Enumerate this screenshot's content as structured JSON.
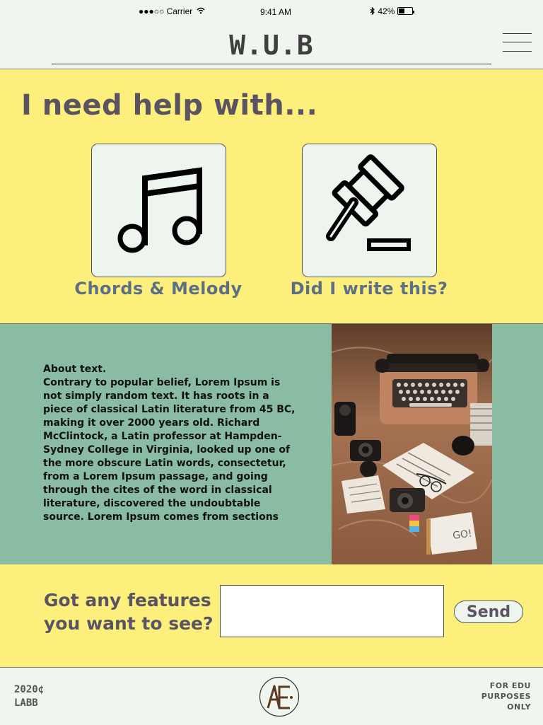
{
  "status_bar": {
    "carrier": "●●●○○ Carrier",
    "time": "9:41 AM",
    "battery": "42%"
  },
  "header": {
    "title": "W.U.B"
  },
  "help": {
    "heading": "I need help with...",
    "cards": [
      {
        "label": "Chords & Melody",
        "icon": "music-note-icon"
      },
      {
        "label": "Did I write this?",
        "icon": "gavel-icon"
      }
    ]
  },
  "about": {
    "title": "About text.",
    "body": "Contrary to popular belief, Lorem Ipsum is not simply random text. It has roots in a piece of classical Latin literature from 45 BC, making it over 2000 years old. Richard McClintock, a Latin professor at Hampden-Sydney College in Virginia, looked up one of the more obscure Latin words, consectetur, from a Lorem Ipsum passage, and going through the cites of the word in classical literature, discovered the undoubtable source. Lorem Ipsum comes from sections",
    "image": "typewriter-desk-photo",
    "photo_note": "GO!"
  },
  "feedback": {
    "line1": "Got any features",
    "line2": "you want to see?",
    "input_value": "",
    "send_label": "Send"
  },
  "footer": {
    "left_line1": "2020¢",
    "left_line2": "LABB",
    "logo": "AE",
    "right_line1": "FOR EDU",
    "right_line2": "PURPOSES",
    "right_line3": "ONLY"
  },
  "colors": {
    "yellow": "#fdef7c",
    "green": "#89bca3",
    "header_bg": "#f0f5ef",
    "heading_text": "#5a5462",
    "card_label": "#5d6f86"
  }
}
